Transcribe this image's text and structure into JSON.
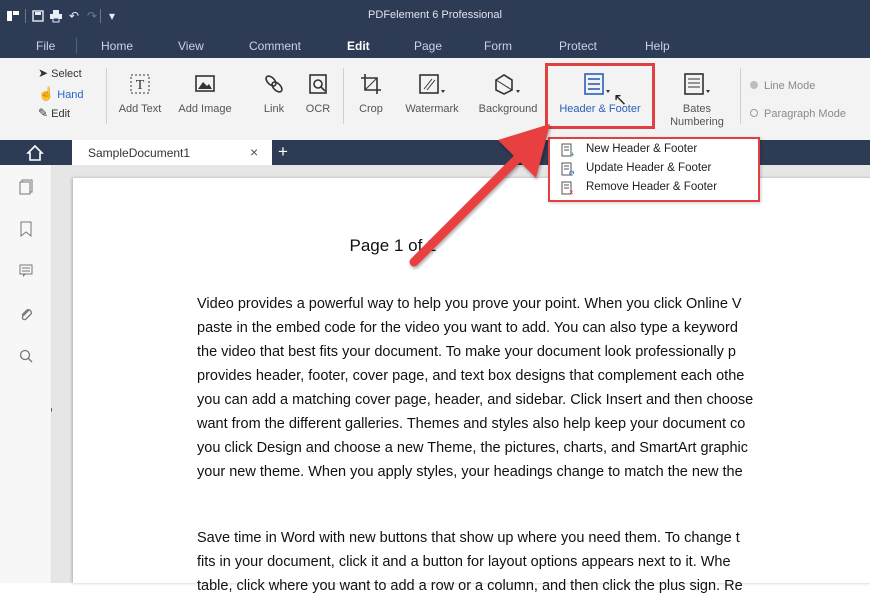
{
  "app": {
    "title": "PDFelement 6 Professional",
    "accent": "#2e3b55",
    "highlight_color": "#e04040"
  },
  "menu": {
    "items": [
      "File",
      "Home",
      "View",
      "Comment",
      "Edit",
      "Page",
      "Form",
      "Protect",
      "Help"
    ],
    "active": "Edit"
  },
  "ribbon": {
    "select_label": "Select",
    "hand_label": "Hand",
    "edit_label": "Edit",
    "tools": [
      {
        "label": "Add Text",
        "icon": "add-text-icon"
      },
      {
        "label": "Add Image",
        "icon": "add-image-icon"
      },
      {
        "label": "Link",
        "icon": "link-icon"
      },
      {
        "label": "OCR",
        "icon": "ocr-icon"
      },
      {
        "label": "Crop",
        "icon": "crop-icon"
      },
      {
        "label": "Watermark",
        "icon": "watermark-icon"
      },
      {
        "label": "Background",
        "icon": "background-icon"
      },
      {
        "label": "Header & Footer",
        "icon": "header-footer-icon"
      },
      {
        "label": "Bates\nNumbering",
        "icon": "bates-numbering-icon"
      }
    ],
    "modes": [
      "Line Mode",
      "Paragraph Mode"
    ]
  },
  "tabs": {
    "document_name": "SampleDocument1"
  },
  "dropdown": {
    "items": [
      "New Header & Footer",
      "Update Header & Footer",
      "Remove Header & Footer"
    ]
  },
  "page": {
    "header": "Page 1 of 2",
    "paragraph1": [
      "Video provides a powerful way to help you prove your point. When you click Online V",
      "paste in the embed code for the video you want to add. You can also type a keyword",
      "the video that best fits your document. To make your document look professionally p",
      "provides header, footer, cover page, and text box designs that complement each othe",
      "you can add a matching cover page, header, and sidebar. Click Insert and then choose",
      "want from the different galleries. Themes and styles also help keep your document co",
      "you click Design and choose a new Theme, the pictures, charts, and SmartArt graphic",
      "your new theme. When you apply styles, your headings change to match the new the"
    ],
    "paragraph2": [
      "Save time in Word with new buttons that show up where you need them. To change t",
      "fits in your document, click it and a button for layout options appears next to it. Whe",
      "table, click where you want to add a row or a column, and then click the plus sign. Re"
    ]
  }
}
